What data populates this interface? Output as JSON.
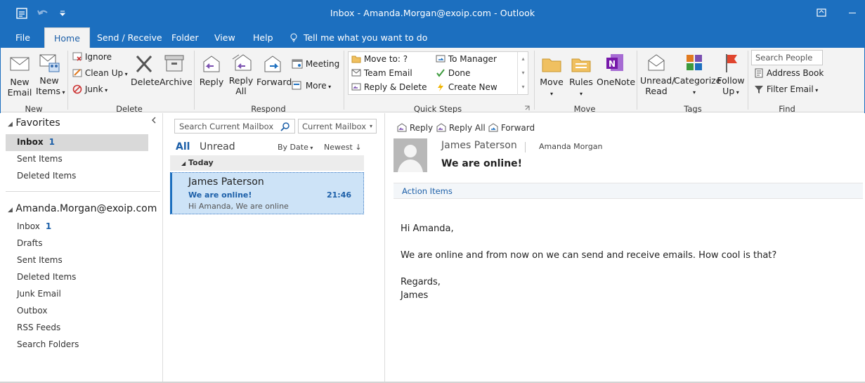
{
  "window": {
    "title": "Inbox - Amanda.Morgan@exoip.com  -  Outlook"
  },
  "tabs": [
    {
      "label": "File"
    },
    {
      "label": "Home"
    },
    {
      "label": "Send / Receive"
    },
    {
      "label": "Folder"
    },
    {
      "label": "View"
    },
    {
      "label": "Help"
    }
  ],
  "tell_me": {
    "label": "Tell me what you want to do"
  },
  "ribbon": {
    "new_group": {
      "label": "New",
      "new_email": "New Email",
      "new_email_l1": "New",
      "new_email_l2": "Email",
      "new_items_l1": "New",
      "new_items_l2": "Items"
    },
    "delete_group": {
      "label": "Delete",
      "ignore": "Ignore",
      "clean_up": "Clean Up",
      "junk": "Junk",
      "delete": "Delete",
      "archive": "Archive"
    },
    "respond_group": {
      "label": "Respond",
      "reply": "Reply",
      "reply_all_l1": "Reply",
      "reply_all_l2": "All",
      "forward": "Forward",
      "meeting": "Meeting",
      "more": "More"
    },
    "quick_steps": {
      "label": "Quick Steps",
      "items": [
        "Move to: ?",
        "Team Email",
        "Reply & Delete",
        "To Manager",
        "Done",
        "Create New"
      ]
    },
    "move_group": {
      "label": "Move",
      "move": "Move",
      "rules": "Rules",
      "onenote": "OneNote"
    },
    "tags_group": {
      "label": "Tags",
      "unread_l1": "Unread/",
      "unread_l2": "Read",
      "categorize": "Categorize",
      "follow_l1": "Follow",
      "follow_l2": "Up"
    },
    "find_group": {
      "label": "Find",
      "search_people_placeholder": "Search People",
      "address_book": "Address Book",
      "filter_email": "Filter Email"
    }
  },
  "folders": {
    "favorites_label": "Favorites",
    "favorites": [
      {
        "label": "Inbox",
        "count": "1"
      },
      {
        "label": "Sent Items"
      },
      {
        "label": "Deleted Items"
      }
    ],
    "account": "Amanda.Morgan@exoip.com",
    "account_folders": [
      {
        "label": "Inbox",
        "count": "1"
      },
      {
        "label": "Drafts"
      },
      {
        "label": "Sent Items"
      },
      {
        "label": "Deleted Items"
      },
      {
        "label": "Junk Email"
      },
      {
        "label": "Outbox"
      },
      {
        "label": "RSS Feeds"
      },
      {
        "label": "Search Folders"
      }
    ]
  },
  "message_list": {
    "search_placeholder": "Search Current Mailbox",
    "scope": "Current Mailbox",
    "filter_all": "All",
    "filter_unread": "Unread",
    "sort_by": "By Date",
    "sort_order": "Newest",
    "group_label": "Today",
    "messages": [
      {
        "sender": "James Paterson",
        "subject": "We are online!",
        "time": "21:46",
        "preview": "Hi Amanda,  We are online"
      }
    ]
  },
  "reading": {
    "actions": {
      "reply": "Reply",
      "reply_all": "Reply All",
      "forward": "Forward"
    },
    "sender": "James Paterson",
    "to": "Amanda Morgan",
    "subject": "We are online!",
    "action_items": "Action Items",
    "body": {
      "greeting": "Hi Amanda,",
      "line1": "We are online and from now on we can send and receive emails. How cool is that?",
      "closing": "Regards,",
      "signature": "James"
    }
  },
  "colors": {
    "brand": "#1c6fbf",
    "accent": "#1c5fa8",
    "selection": "#cde3f7"
  }
}
